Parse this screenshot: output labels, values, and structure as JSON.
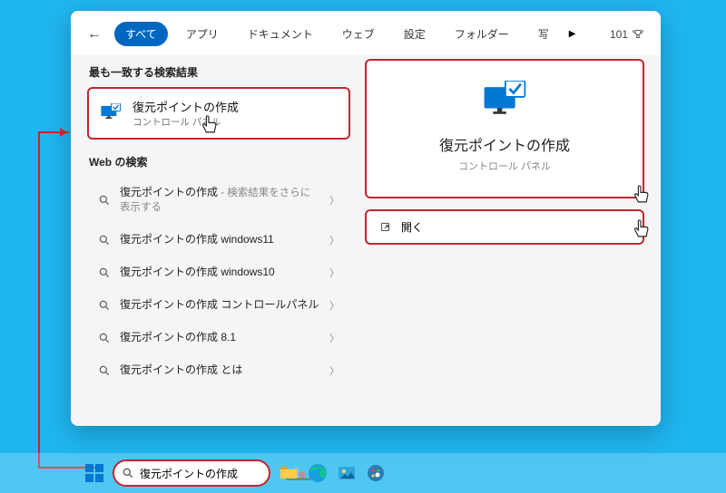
{
  "tabs": {
    "all": "すべて",
    "apps": "アプリ",
    "documents": "ドキュメント",
    "web": "ウェブ",
    "settings": "設定",
    "folders": "フォルダー",
    "photos": "写"
  },
  "rewards_count": "101",
  "section_best_match": "最も一致する検索結果",
  "best_match": {
    "title": "復元ポイントの作成",
    "subtitle": "コントロール パネル"
  },
  "section_web": "Web の検索",
  "web_results": [
    {
      "label": "復元ポイントの作成",
      "suffix": " - 検索結果をさらに表示する"
    },
    {
      "label": "復元ポイントの作成 windows11",
      "suffix": ""
    },
    {
      "label": "復元ポイントの作成 windows10",
      "suffix": ""
    },
    {
      "label": "復元ポイントの作成 コントロールパネル",
      "suffix": ""
    },
    {
      "label": "復元ポイントの作成 8.1",
      "suffix": ""
    },
    {
      "label": "復元ポイントの作成 とは",
      "suffix": ""
    }
  ],
  "preview": {
    "title": "復元ポイントの作成",
    "subtitle": "コントロール パネル",
    "open_label": "開く"
  },
  "search_query": "復元ポイントの作成"
}
